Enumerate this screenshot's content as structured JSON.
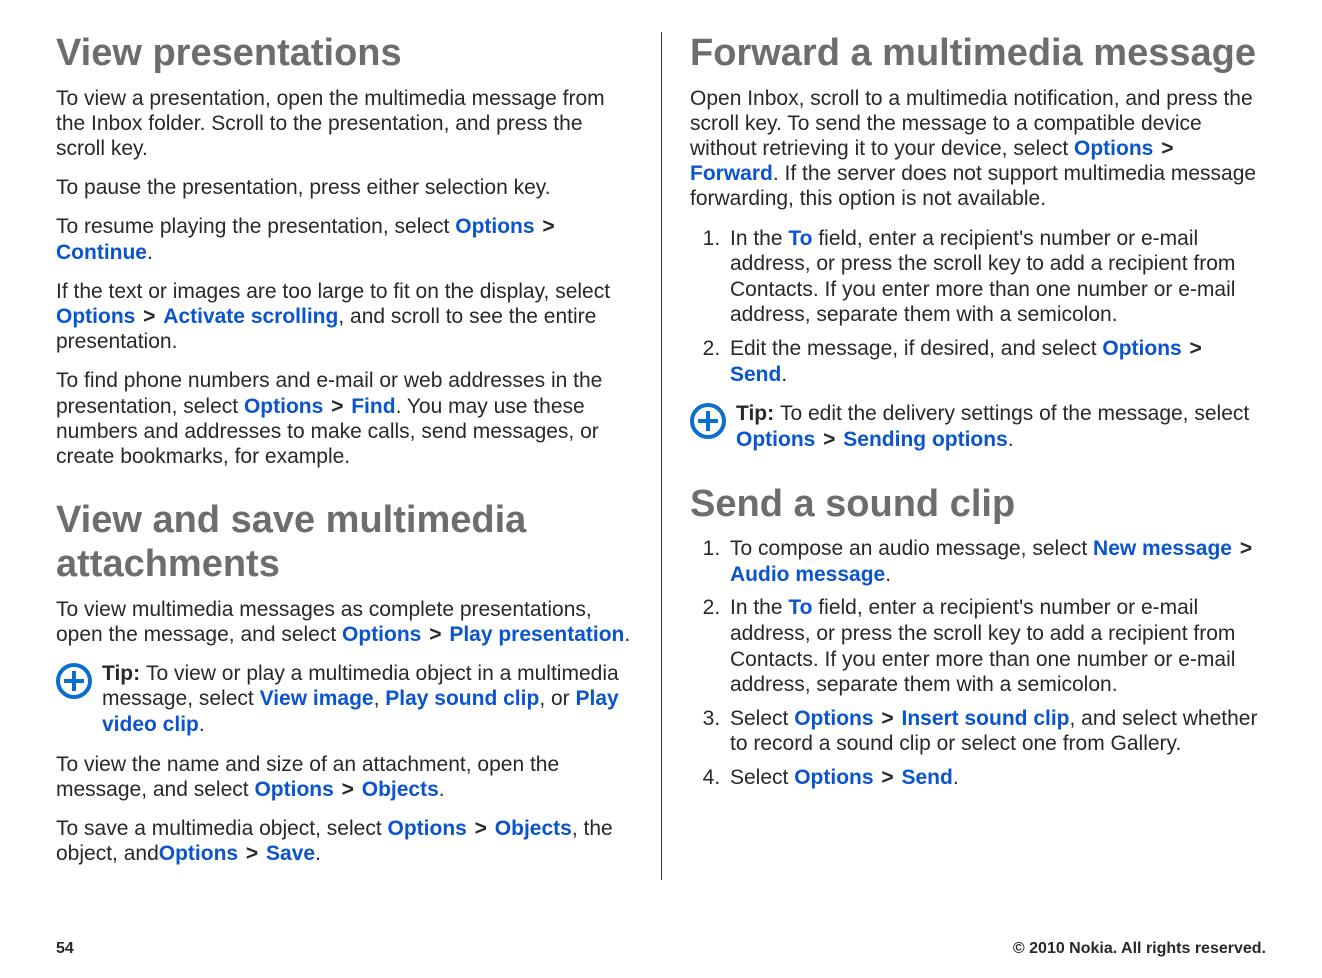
{
  "left": {
    "h1a": "View presentations",
    "p1": {
      "t": "To view a presentation, open the multimedia message from the Inbox folder. Scroll to the presentation, and press the scroll key."
    },
    "p2": {
      "t": "To pause the presentation, press either selection key."
    },
    "p3": {
      "a": "To resume playing the presentation, select ",
      "k1": "Options",
      "k2": "Continue",
      "b": "."
    },
    "p4": {
      "a": "If the text or images are too large to fit on the display, select ",
      "k1": "Options",
      "k2": "Activate scrolling",
      "b": ", and scroll to see the entire presentation."
    },
    "p5": {
      "a": "To find phone numbers and e-mail or web addresses in the presentation, select ",
      "k1": "Options",
      "k2": "Find",
      "b": ". You may use these numbers and addresses to make calls, send messages, or create bookmarks, for example."
    },
    "h1b": "View and save multimedia attachments",
    "p6": {
      "a": "To view multimedia messages as complete presentations, open the message, and select ",
      "k1": "Options",
      "k2": "Play presentation",
      "b": "."
    },
    "tip": {
      "lead": "Tip: ",
      "a": "To view or play a multimedia object in a multimedia message, select ",
      "k1": "View image",
      "sep1": ", ",
      "k2": "Play sound clip",
      "sep2": ", or ",
      "k3": "Play video clip",
      "b": "."
    },
    "p7": {
      "a": "To view the name and size of an attachment, open the message, and select ",
      "k1": "Options",
      "k2": "Objects",
      "b": "."
    },
    "p8": {
      "a": "To save a multimedia object, select ",
      "k1": "Options",
      "k2": "Objects",
      "mid": ", the object, and",
      "k3": "Options",
      "k4": "Save",
      "b": "."
    }
  },
  "right": {
    "h1a": "Forward a multimedia message",
    "p1": {
      "a": "Open Inbox, scroll to a multimedia notification, and press the scroll key. To send the message to a compatible device without retrieving it to your device, select ",
      "k1": "Options",
      "k2": "Forward",
      "b": ". If the server does not support multimedia message forwarding, this option is not available."
    },
    "ol1": {
      "i1": {
        "a": "In the ",
        "k1": "To",
        "b": " field, enter a recipient's number or e-mail address, or press the scroll key to add a recipient from Contacts. If you enter more than one number or e-mail address, separate them with a semicolon."
      },
      "i2": {
        "a": "Edit the message, if desired, and select ",
        "k1": "Options",
        "k2": "Send",
        "b": "."
      }
    },
    "tip": {
      "lead": "Tip: ",
      "a": "To edit the delivery settings of the message, select ",
      "k1": "Options",
      "k2": "Sending options",
      "b": "."
    },
    "h1b": "Send a sound clip",
    "ol2": {
      "i1": {
        "a": "To compose an audio message, select ",
        "k1": "New message",
        "k2": "Audio message",
        "b": "."
      },
      "i2": {
        "a": "In the ",
        "k1": "To",
        "b": " field, enter a recipient's number or e-mail address, or press the scroll key to add a recipient from Contacts. If you enter more than one number or e-mail address, separate them with a semicolon."
      },
      "i3": {
        "a": "Select ",
        "k1": "Options",
        "k2": "Insert sound clip",
        "b": ", and select whether to record a sound clip or select one from Gallery."
      },
      "i4": {
        "a": "Select ",
        "k1": "Options",
        "k2": "Send",
        "b": "."
      }
    }
  },
  "footer": {
    "page": "54",
    "copy": "© 2010 Nokia. All rights reserved."
  },
  "gt": ">"
}
